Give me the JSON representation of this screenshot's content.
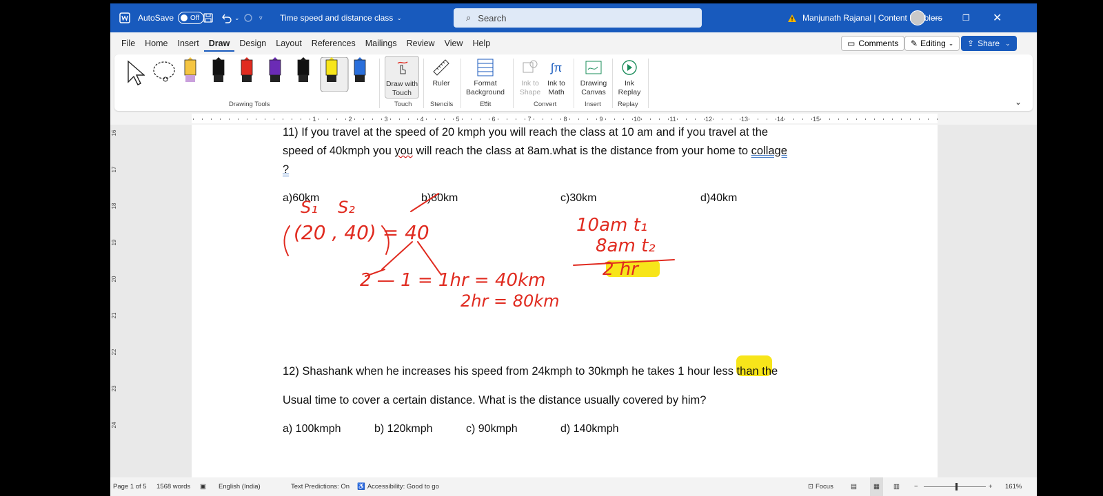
{
  "titlebar": {
    "autosave_label": "AutoSave",
    "autosave_state": "Off",
    "doc_title": "Time speed and distance class",
    "search_placeholder": "Search",
    "user": "Manjunath Rajanal | Content Enablers"
  },
  "menu": {
    "tabs": [
      "File",
      "Home",
      "Insert",
      "Draw",
      "Design",
      "Layout",
      "References",
      "Mailings",
      "Review",
      "View",
      "Help"
    ],
    "active": "Draw",
    "comments": "Comments",
    "editing": "Editing",
    "share": "Share"
  },
  "ribbon": {
    "groups": {
      "drawing_tools": "Drawing Tools",
      "touch": "Touch",
      "stencils": "Stencils",
      "edit": "Edit",
      "convert": "Convert",
      "insert": "Insert",
      "replay": "Replay"
    },
    "draw_with_touch": [
      "Draw with",
      "Touch"
    ],
    "ruler": "Ruler",
    "format_background": [
      "Format",
      "Background"
    ],
    "ink_to_shape": [
      "Ink to",
      "Shape"
    ],
    "ink_to_math": [
      "Ink to",
      "Math"
    ],
    "drawing_canvas": [
      "Drawing",
      "Canvas"
    ],
    "ink_replay": [
      "Ink",
      "Replay"
    ],
    "pen_colors": [
      "#f5c542",
      "#111111",
      "#e02b20",
      "#6b2bb5",
      "#111111",
      "#f7e51a",
      "#2a6fdb"
    ]
  },
  "ruler_numbers": [
    "1",
    "2",
    "3",
    "4",
    "5",
    "6",
    "7",
    "8",
    "9",
    "10",
    "11",
    "12",
    "13",
    "14",
    "15"
  ],
  "vruler_numbers": [
    "16",
    "17",
    "18",
    "19",
    "20",
    "21",
    "22",
    "23",
    "24"
  ],
  "doc": {
    "q11_line1": "11) If you travel at the speed of 20 kmph you will reach the class at 10 am and if you travel at the",
    "q11_line2_a": "speed of 40kmph you ",
    "q11_line2_b": "you",
    "q11_line2_c": " will reach the class at 8am.what is the distance from your home to ",
    "q11_line2_d": "collage",
    "q11_line3": "?",
    "q11_opts": [
      "a)60km",
      "b)80km",
      "c)30km",
      "d)40km"
    ],
    "q12_line1_a": "12) Shashank when he increases his speed from 24kmph to 30kmph he takes 1 ",
    "q12_line1_b": "hour",
    "q12_line1_c": " less than the",
    "q12_line2": "Usual time to cover a certain distance. What is the distance usually covered by him?",
    "q12_opts": [
      "a) 100kmph",
      "b) 120kmph",
      "c) 90kmph",
      "d) 140kmph"
    ]
  },
  "ink": {
    "s_labels": [
      "S₁",
      "S₂"
    ],
    "ratio": "(20 , 40) = 40",
    "split": "2  —  1 = 1hr = 40km",
    "second": "2hr = 80km",
    "t1": "10am t₁",
    "t2": "8am t₂",
    "diff": "2 hr",
    "ink_color": "#e02b20",
    "highlight_color": "#f7e51a"
  },
  "status": {
    "page": "Page 1 of 5",
    "words": "1568 words",
    "language": "English (India)",
    "predictions": "Text Predictions: On",
    "accessibility": "Accessibility: Good to go",
    "focus": "Focus",
    "zoom": "161%"
  }
}
